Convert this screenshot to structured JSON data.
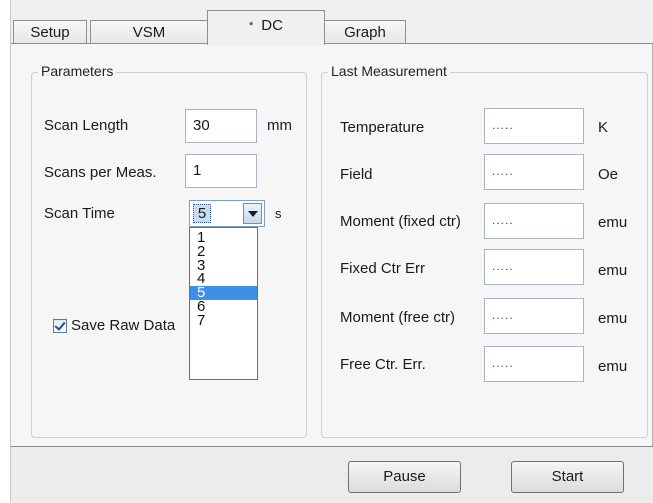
{
  "tabs": [
    {
      "label": "Setup"
    },
    {
      "label": "VSM"
    },
    {
      "label": "DC",
      "modified_marker": "*"
    },
    {
      "label": "Graph"
    }
  ],
  "parameters": {
    "title": "Parameters",
    "scan_length": {
      "label": "Scan Length",
      "value": "30",
      "unit": "mm"
    },
    "scans_per_meas": {
      "label": "Scans per Meas.",
      "value": "1"
    },
    "scan_time": {
      "label": "Scan Time",
      "value": "5",
      "unit": "s",
      "options": [
        "1",
        "2",
        "3",
        "4",
        "5",
        "6",
        "7"
      ],
      "highlighted": "5"
    },
    "save_raw_data": {
      "label": "Save Raw Data",
      "checked": true
    }
  },
  "last_measurement": {
    "title": "Last Measurement",
    "rows": [
      {
        "label": "Temperature",
        "value": ".....",
        "unit": "K"
      },
      {
        "label": "Field",
        "value": ".....",
        "unit": "Oe"
      },
      {
        "label": "Moment (fixed ctr)",
        "value": ".....",
        "unit": "emu"
      },
      {
        "label": "Fixed Ctr Err",
        "value": ".....",
        "unit": "emu"
      },
      {
        "label": "Moment (free ctr)",
        "value": ".....",
        "unit": "emu"
      },
      {
        "label": "Free Ctr. Err.",
        "value": ".....",
        "unit": "emu"
      }
    ]
  },
  "buttons": {
    "pause": "Pause",
    "start": "Start"
  },
  "colors": {
    "selection": "#3f8ee8",
    "window_bg": "#f0f0f0"
  }
}
